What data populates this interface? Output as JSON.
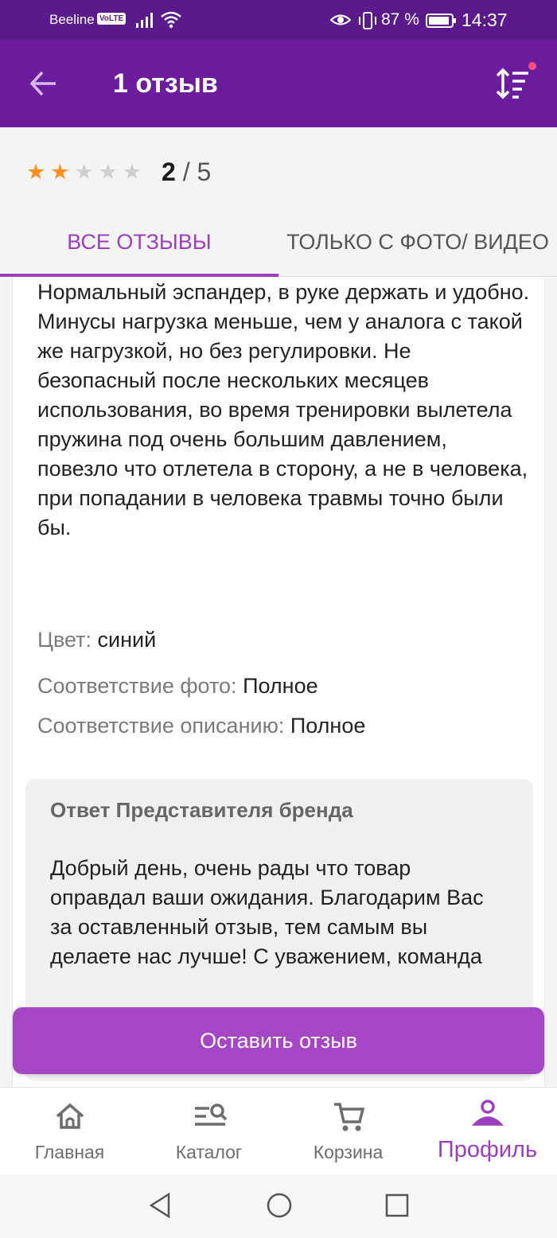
{
  "status_bar": {
    "carrier": "Beeline",
    "volte": "VoLTE",
    "battery_percent": "87 %",
    "time": "14:37",
    "icons": [
      "signal-icon",
      "wifi-icon",
      "eye-icon",
      "vibrate-icon",
      "battery-icon"
    ]
  },
  "app_bar": {
    "title": "1 отзыв",
    "back_icon": "arrow-left-icon",
    "sort_icon": "sort-icon",
    "sort_badge_color": "#ff4d7d",
    "background": "#6c1d9e"
  },
  "summary": {
    "rating": 2,
    "max_rating": 5,
    "rating_value": "2",
    "rating_max_text": "5",
    "separator": " / ",
    "star_color": "#ff8f1c"
  },
  "tabs": [
    {
      "label": "Все отзывы",
      "active": true
    },
    {
      "label": "Только с фото/ видео",
      "active": false
    }
  ],
  "review": {
    "text": "Нормальный эспандер, в руке держать и удобно. Минусы нагрузка меньше, чем у аналога с такой же нагрузкой, но без регулировки. Не безопасный после нескольких месяцев использования, во время тренировки вылетела пружина под очень большим давлением, повезло что отлетела в сторону, а не в человека, при попадании в человека травмы точно были бы.",
    "attributes": [
      {
        "key": "Цвет:",
        "value": "синий"
      },
      {
        "key": "Соответствие фото:",
        "value": "Полное"
      },
      {
        "key": "Соответствие описанию:",
        "value": "Полное"
      }
    ]
  },
  "brand_reply": {
    "title": "Ответ Представителя бренда",
    "text": "Добрый день, очень рады что товар оправдал ваши ожидания. Благодарим Вас за оставленный отзыв, тем самым вы делаете нас лучше! С уважением, команда"
  },
  "cta": {
    "label": "Оставить отзыв",
    "color": "#a547c4"
  },
  "bottom_nav": {
    "items": [
      {
        "label": "Главная",
        "icon": "home-icon",
        "active": false
      },
      {
        "label": "Каталог",
        "icon": "catalog-search-icon",
        "active": false
      },
      {
        "label": "Корзина",
        "icon": "cart-icon",
        "active": false
      },
      {
        "label": "Профиль",
        "icon": "profile-icon",
        "active": true
      }
    ],
    "active_color": "#9b3fbf"
  },
  "system_nav": {
    "icons": [
      "back-triangle-icon",
      "home-circle-icon",
      "recents-square-icon"
    ]
  }
}
